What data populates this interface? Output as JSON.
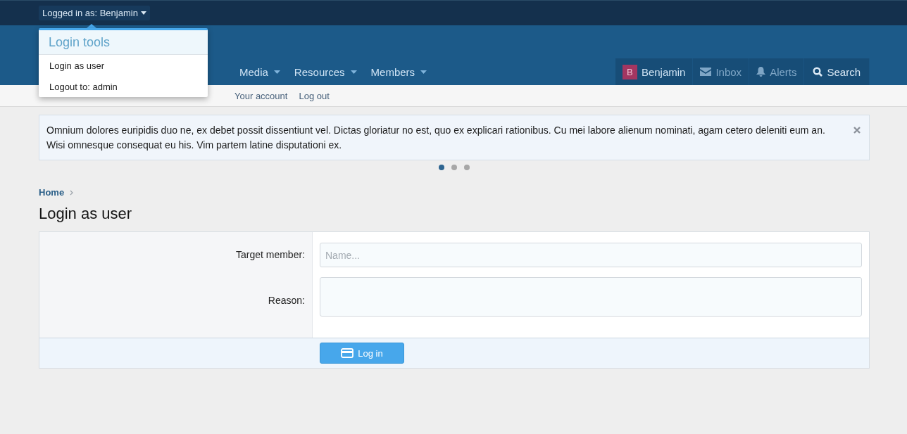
{
  "top_bar": {
    "account_menu": {
      "label": "Logged in as: Benjamin",
      "expanded": true
    }
  },
  "login_tools_menu": {
    "title": "Login tools",
    "items": [
      {
        "label": "Login as user"
      },
      {
        "label": "Logout to: admin"
      }
    ]
  },
  "nav": {
    "tabs": [
      {
        "label": "Media"
      },
      {
        "label": "Resources"
      },
      {
        "label": "Members"
      }
    ],
    "user": {
      "avatar_letter": "B",
      "name": "Benjamin"
    },
    "inbox": "Inbox",
    "alerts": "Alerts",
    "search": "Search"
  },
  "sub_nav": [
    "Your account",
    "Log out"
  ],
  "notice": {
    "text": "Omnium dolores euripidis duo ne, ex debet possit dissentiunt vel. Dictas gloriatur no est, quo ex explicari rationibus. Cu mei labore alienum nominati, agam cetero deleniti eum an. Wisi omnesque consequat eu his. Vim partem latine disputationi ex.",
    "slides": [
      {
        "selected": true
      },
      {
        "selected": false
      },
      {
        "selected": false
      }
    ]
  },
  "breadcrumb": [
    "Home"
  ],
  "page_title": "Login as user",
  "form": {
    "fields": [
      {
        "label": "Target member:",
        "kind": "input",
        "placeholder": "Name..."
      },
      {
        "label": "Reason:",
        "kind": "textarea"
      }
    ],
    "submit": "Log in"
  }
}
